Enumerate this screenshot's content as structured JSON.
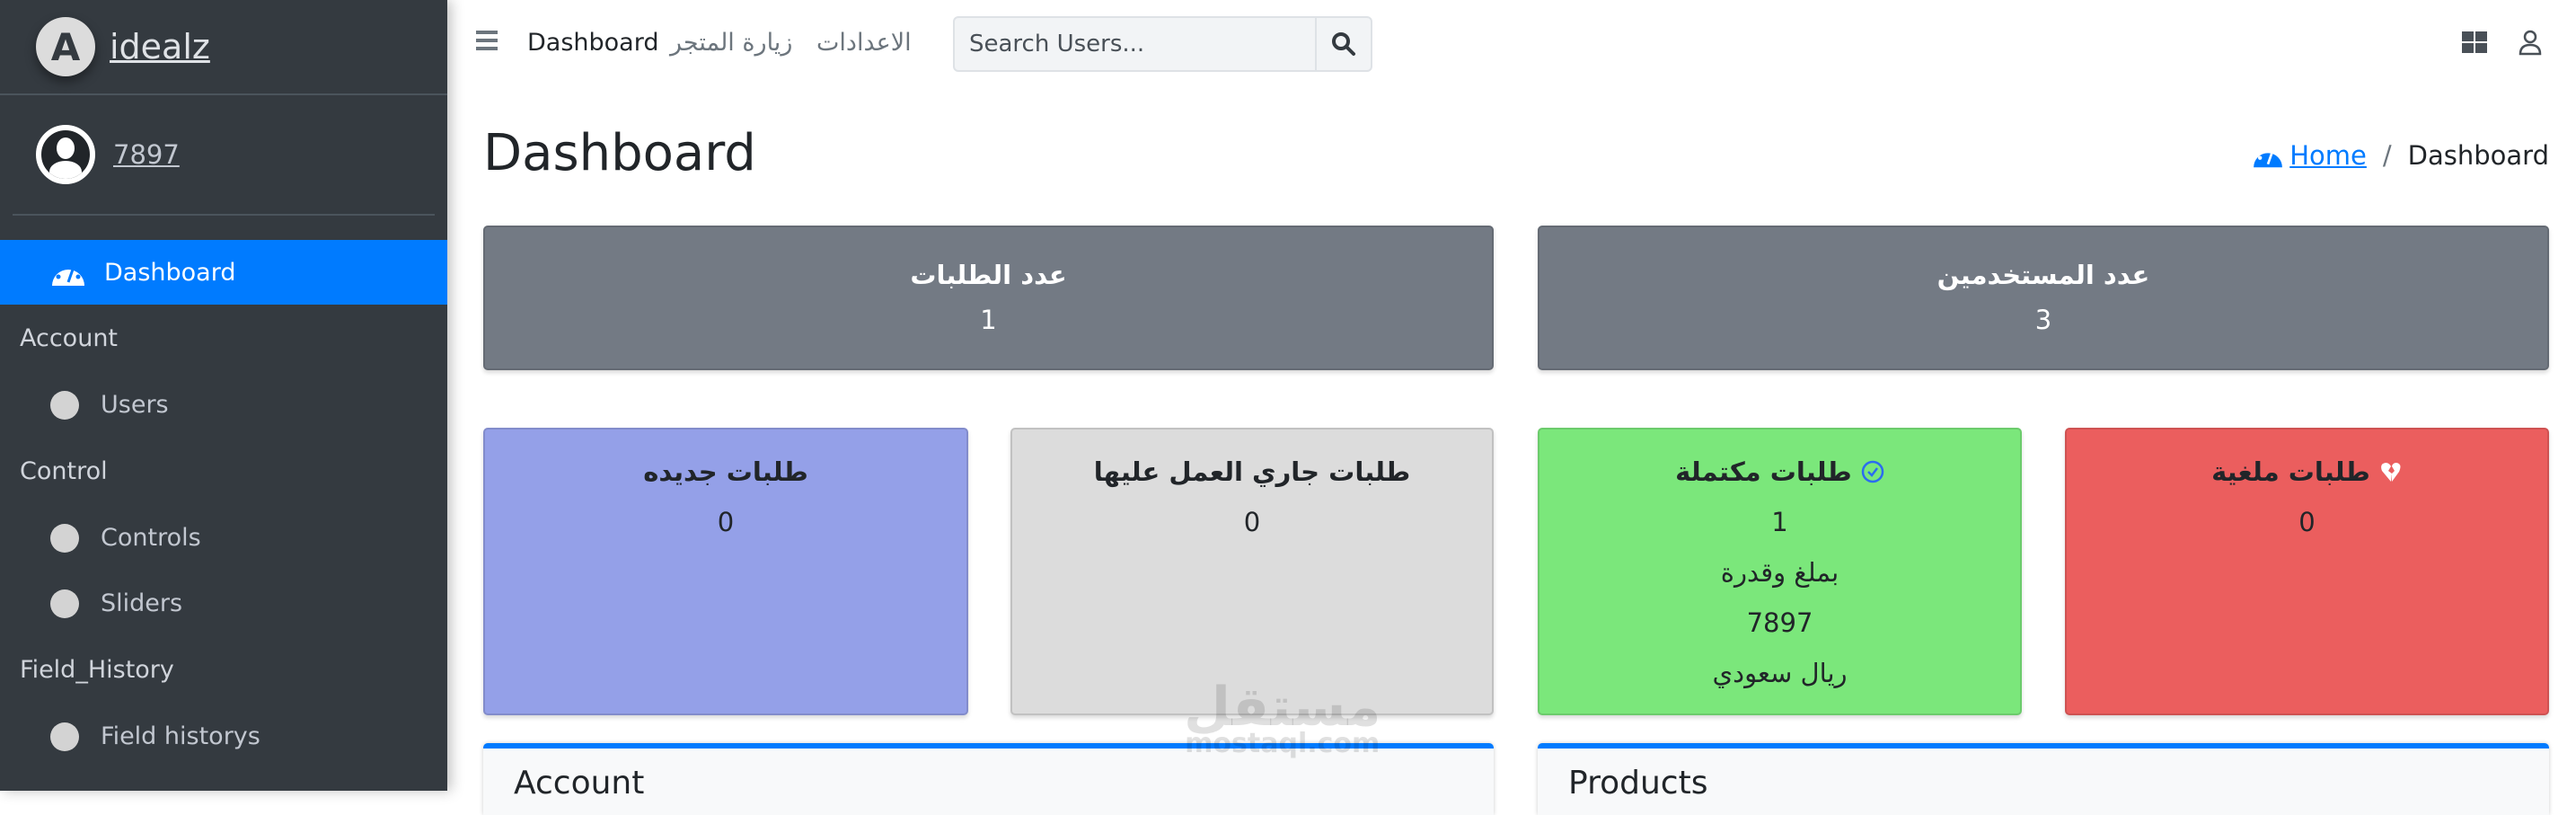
{
  "sidebar": {
    "brand": "idealz",
    "brand_logo_letter": "A",
    "user": "7897",
    "items": [
      {
        "type": "item",
        "label": "Dashboard",
        "active": true
      },
      {
        "type": "header",
        "label": "Account"
      },
      {
        "type": "item",
        "label": "Users"
      },
      {
        "type": "header",
        "label": "Control"
      },
      {
        "type": "item",
        "label": "Controls"
      },
      {
        "type": "item",
        "label": "Sliders"
      },
      {
        "type": "header",
        "label": "Field_History"
      },
      {
        "type": "item",
        "label": "Field historys"
      }
    ]
  },
  "topbar": {
    "dashboard": "Dashboard",
    "visit_store": "زيارة المتجر",
    "settings": "الاعدادات",
    "search_placeholder": "Search Users..."
  },
  "page": {
    "title": "Dashboard",
    "breadcrumb_home": "Home",
    "breadcrumb_current": "Dashboard",
    "breadcrumb_sep": "/"
  },
  "stats_top": [
    {
      "title": "عدد الطلبات",
      "value": "1"
    },
    {
      "title": "عدد المستخدمين",
      "value": "3"
    }
  ],
  "stats": [
    {
      "title": "طلبات جديده",
      "value": "0",
      "color": "#94a0e8"
    },
    {
      "title": "طلبات جاري العمل عليها",
      "value": "0",
      "color": "#dcdcdc"
    },
    {
      "title": "طلبات مكتملة",
      "value": "1",
      "amount_label": "بملغ وقدرة",
      "amount": "7897",
      "currency": "ريال سعودي",
      "color": "#7be77b"
    },
    {
      "title": "طلبات ملغية",
      "value": "0",
      "color": "#eb5e5e"
    }
  ],
  "panels": {
    "account": "Account",
    "products": "Products"
  },
  "watermark": {
    "ar": "مستقل",
    "en": "mostaql.com"
  }
}
